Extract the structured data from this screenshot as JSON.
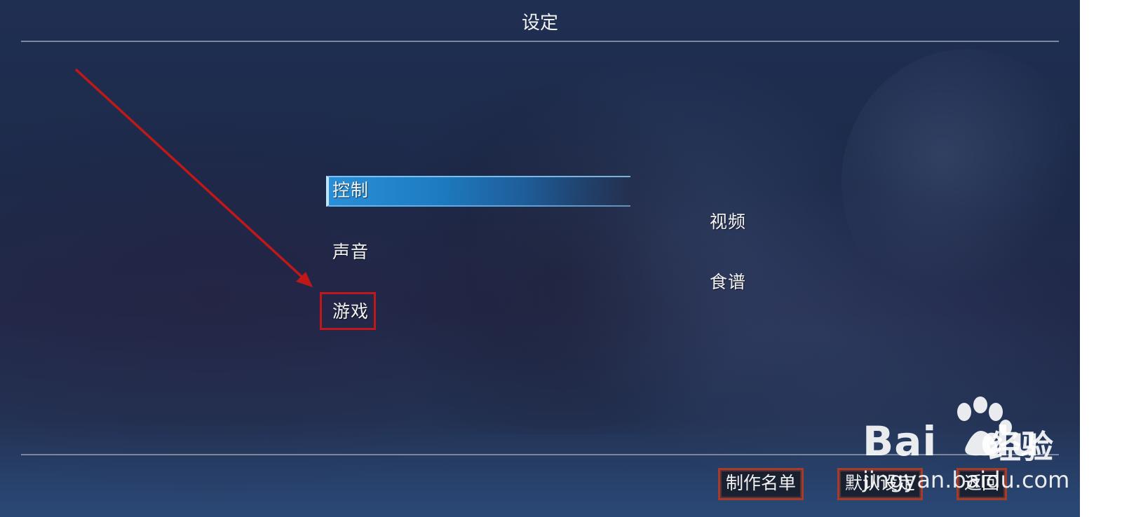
{
  "header": {
    "title": "设定"
  },
  "menu": {
    "left": [
      {
        "label": "控制",
        "selected": true
      },
      {
        "label": "声音",
        "selected": false
      },
      {
        "label": "游戏",
        "selected": false
      }
    ],
    "right": [
      {
        "label": "视频",
        "selected": false
      },
      {
        "label": "食谱",
        "selected": false
      }
    ]
  },
  "footer": {
    "buttons": [
      {
        "label": "制作名单"
      },
      {
        "label": "默认设定"
      },
      {
        "label": "返回"
      }
    ]
  },
  "watermark": {
    "logo": "Bai",
    "logo_suffix": "du",
    "cn": "经验",
    "url": "jingyan.baidu.com"
  },
  "colors": {
    "highlight": "#2a8fd6",
    "annotation": "#c01818",
    "button_border": "#a83a2a"
  }
}
